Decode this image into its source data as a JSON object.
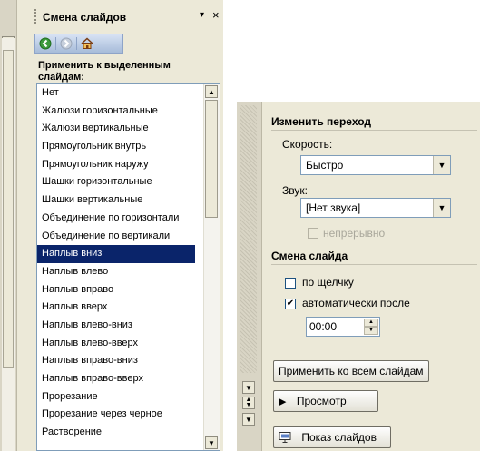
{
  "left_pane": {
    "title": "Смена слайдов",
    "menu_arrow": "▾",
    "close_glyph": "×",
    "nav": {
      "back_icon": "back-icon",
      "forward_icon": "forward-icon",
      "home_icon": "home-icon"
    },
    "apply_label": "Применить к выделенным слайдам:",
    "transitions": [
      "Нет",
      "Жалюзи горизонтальные",
      "Жалюзи вертикальные",
      "Прямоугольник внутрь",
      "Прямоугольник наружу",
      "Шашки горизонтальные",
      "Шашки вертикальные",
      "Объединение по горизонтали",
      "Объединение по вертикали",
      "Наплыв вниз",
      "Наплыв влево",
      "Наплыв вправо",
      "Наплыв вверх",
      "Наплыв влево-вниз",
      "Наплыв влево-вверх",
      "Наплыв вправо-вниз",
      "Наплыв вправо-вверх",
      "Прорезание",
      "Прорезание через черное",
      "Растворение"
    ],
    "selected_transition": "Наплыв вниз"
  },
  "right_pane": {
    "change_transition_title": "Изменить переход",
    "speed_label": "Скорость:",
    "speed_value": "Быстро",
    "sound_label": "Звук:",
    "sound_value": "[Нет звука]",
    "loop_label": "непрерывно",
    "advance_title": "Смена слайда",
    "on_click_label": "по щелчку",
    "on_click_checked": false,
    "auto_after_label": "автоматически после",
    "auto_after_checked": true,
    "auto_after_value": "00:00",
    "apply_all_label": "Применить ко всем слайдам",
    "preview_label": "Просмотр",
    "slideshow_label": "Показ слайдов"
  },
  "colors": {
    "selection": "#0a246a",
    "pane_bg": "#ece9d8",
    "nav_gradient_top": "#d7e2f4",
    "nav_gradient_bottom": "#a7bcd9"
  }
}
